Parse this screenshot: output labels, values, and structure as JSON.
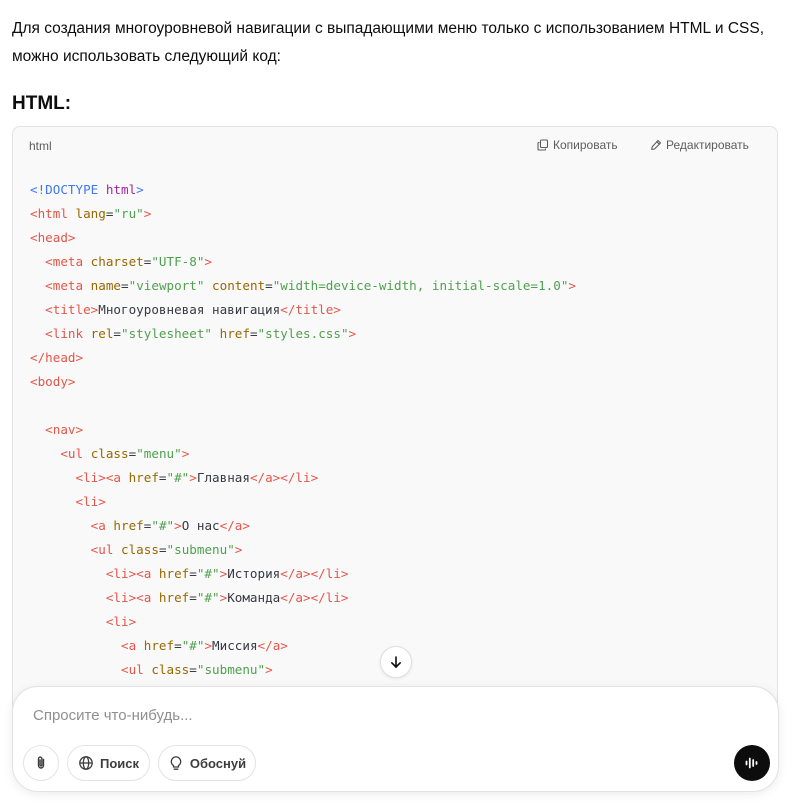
{
  "intro_text": "Для создания многоуровневой навигации с выпадающими меню только с использованием HTML и CSS, можно использовать следующий код:",
  "section_heading": "HTML:",
  "code_block": {
    "language": "html",
    "copy_label": "Копировать",
    "edit_label": "Редактировать",
    "lines": [
      [
        {
          "t": "doc",
          "v": "<!DOCTYPE "
        },
        {
          "t": "kw",
          "v": "html"
        },
        {
          "t": "doc",
          "v": ">"
        }
      ],
      [
        {
          "t": "tag",
          "v": "<html "
        },
        {
          "t": "attr",
          "v": "lang"
        },
        {
          "t": "txt",
          "v": "="
        },
        {
          "t": "str",
          "v": "\"ru\""
        },
        {
          "t": "tag",
          "v": ">"
        }
      ],
      [
        {
          "t": "tag",
          "v": "<head>"
        }
      ],
      [
        {
          "t": "txt",
          "v": "  "
        },
        {
          "t": "tag",
          "v": "<meta "
        },
        {
          "t": "attr",
          "v": "charset"
        },
        {
          "t": "txt",
          "v": "="
        },
        {
          "t": "str",
          "v": "\"UTF-8\""
        },
        {
          "t": "tag",
          "v": ">"
        }
      ],
      [
        {
          "t": "txt",
          "v": "  "
        },
        {
          "t": "tag",
          "v": "<meta "
        },
        {
          "t": "attr",
          "v": "name"
        },
        {
          "t": "txt",
          "v": "="
        },
        {
          "t": "str",
          "v": "\"viewport\""
        },
        {
          "t": "txt",
          "v": " "
        },
        {
          "t": "attr",
          "v": "content"
        },
        {
          "t": "txt",
          "v": "="
        },
        {
          "t": "str",
          "v": "\"width=device-width, initial-scale=1.0\""
        },
        {
          "t": "tag",
          "v": ">"
        }
      ],
      [
        {
          "t": "txt",
          "v": "  "
        },
        {
          "t": "tag",
          "v": "<title>"
        },
        {
          "t": "txt",
          "v": "Многоуровневая навигация"
        },
        {
          "t": "tag",
          "v": "</title>"
        }
      ],
      [
        {
          "t": "txt",
          "v": "  "
        },
        {
          "t": "tag",
          "v": "<link "
        },
        {
          "t": "attr",
          "v": "rel"
        },
        {
          "t": "txt",
          "v": "="
        },
        {
          "t": "str",
          "v": "\"stylesheet\""
        },
        {
          "t": "txt",
          "v": " "
        },
        {
          "t": "attr",
          "v": "href"
        },
        {
          "t": "txt",
          "v": "="
        },
        {
          "t": "str",
          "v": "\"styles.css\""
        },
        {
          "t": "tag",
          "v": ">"
        }
      ],
      [
        {
          "t": "tag",
          "v": "</head>"
        }
      ],
      [
        {
          "t": "tag",
          "v": "<body>"
        }
      ],
      [],
      [
        {
          "t": "txt",
          "v": "  "
        },
        {
          "t": "tag",
          "v": "<nav>"
        }
      ],
      [
        {
          "t": "txt",
          "v": "    "
        },
        {
          "t": "tag",
          "v": "<ul "
        },
        {
          "t": "attr",
          "v": "class"
        },
        {
          "t": "txt",
          "v": "="
        },
        {
          "t": "str",
          "v": "\"menu\""
        },
        {
          "t": "tag",
          "v": ">"
        }
      ],
      [
        {
          "t": "txt",
          "v": "      "
        },
        {
          "t": "tag",
          "v": "<li><a "
        },
        {
          "t": "attr",
          "v": "href"
        },
        {
          "t": "txt",
          "v": "="
        },
        {
          "t": "str",
          "v": "\"#\""
        },
        {
          "t": "tag",
          "v": ">"
        },
        {
          "t": "txt",
          "v": "Главная"
        },
        {
          "t": "tag",
          "v": "</a></li>"
        }
      ],
      [
        {
          "t": "txt",
          "v": "      "
        },
        {
          "t": "tag",
          "v": "<li>"
        }
      ],
      [
        {
          "t": "txt",
          "v": "        "
        },
        {
          "t": "tag",
          "v": "<a "
        },
        {
          "t": "attr",
          "v": "href"
        },
        {
          "t": "txt",
          "v": "="
        },
        {
          "t": "str",
          "v": "\"#\""
        },
        {
          "t": "tag",
          "v": ">"
        },
        {
          "t": "txt",
          "v": "О нас"
        },
        {
          "t": "tag",
          "v": "</a>"
        }
      ],
      [
        {
          "t": "txt",
          "v": "        "
        },
        {
          "t": "tag",
          "v": "<ul "
        },
        {
          "t": "attr",
          "v": "class"
        },
        {
          "t": "txt",
          "v": "="
        },
        {
          "t": "str",
          "v": "\"submenu\""
        },
        {
          "t": "tag",
          "v": ">"
        }
      ],
      [
        {
          "t": "txt",
          "v": "          "
        },
        {
          "t": "tag",
          "v": "<li><a "
        },
        {
          "t": "attr",
          "v": "href"
        },
        {
          "t": "txt",
          "v": "="
        },
        {
          "t": "str",
          "v": "\"#\""
        },
        {
          "t": "tag",
          "v": ">"
        },
        {
          "t": "txt",
          "v": "История"
        },
        {
          "t": "tag",
          "v": "</a></li>"
        }
      ],
      [
        {
          "t": "txt",
          "v": "          "
        },
        {
          "t": "tag",
          "v": "<li><a "
        },
        {
          "t": "attr",
          "v": "href"
        },
        {
          "t": "txt",
          "v": "="
        },
        {
          "t": "str",
          "v": "\"#\""
        },
        {
          "t": "tag",
          "v": ">"
        },
        {
          "t": "txt",
          "v": "Команда"
        },
        {
          "t": "tag",
          "v": "</a></li>"
        }
      ],
      [
        {
          "t": "txt",
          "v": "          "
        },
        {
          "t": "tag",
          "v": "<li>"
        }
      ],
      [
        {
          "t": "txt",
          "v": "            "
        },
        {
          "t": "tag",
          "v": "<a "
        },
        {
          "t": "attr",
          "v": "href"
        },
        {
          "t": "txt",
          "v": "="
        },
        {
          "t": "str",
          "v": "\"#\""
        },
        {
          "t": "tag",
          "v": ">"
        },
        {
          "t": "txt",
          "v": "Миссия"
        },
        {
          "t": "tag",
          "v": "</a>"
        }
      ],
      [
        {
          "t": "txt",
          "v": "            "
        },
        {
          "t": "tag",
          "v": "<ul "
        },
        {
          "t": "attr",
          "v": "class"
        },
        {
          "t": "txt",
          "v": "="
        },
        {
          "t": "str",
          "v": "\"submenu\""
        },
        {
          "t": "tag",
          "v": ">"
        }
      ]
    ]
  },
  "composer": {
    "placeholder": "Спросите что-нибудь...",
    "search_label": "Поиск",
    "reason_label": "Обоснуй"
  },
  "icons": {
    "copy": "copy-icon",
    "edit": "edit-icon",
    "scroll": "arrow-down-icon",
    "attach": "paperclip-icon",
    "globe": "globe-icon",
    "bulb": "lightbulb-icon",
    "voice": "voice-waveform-icon"
  }
}
